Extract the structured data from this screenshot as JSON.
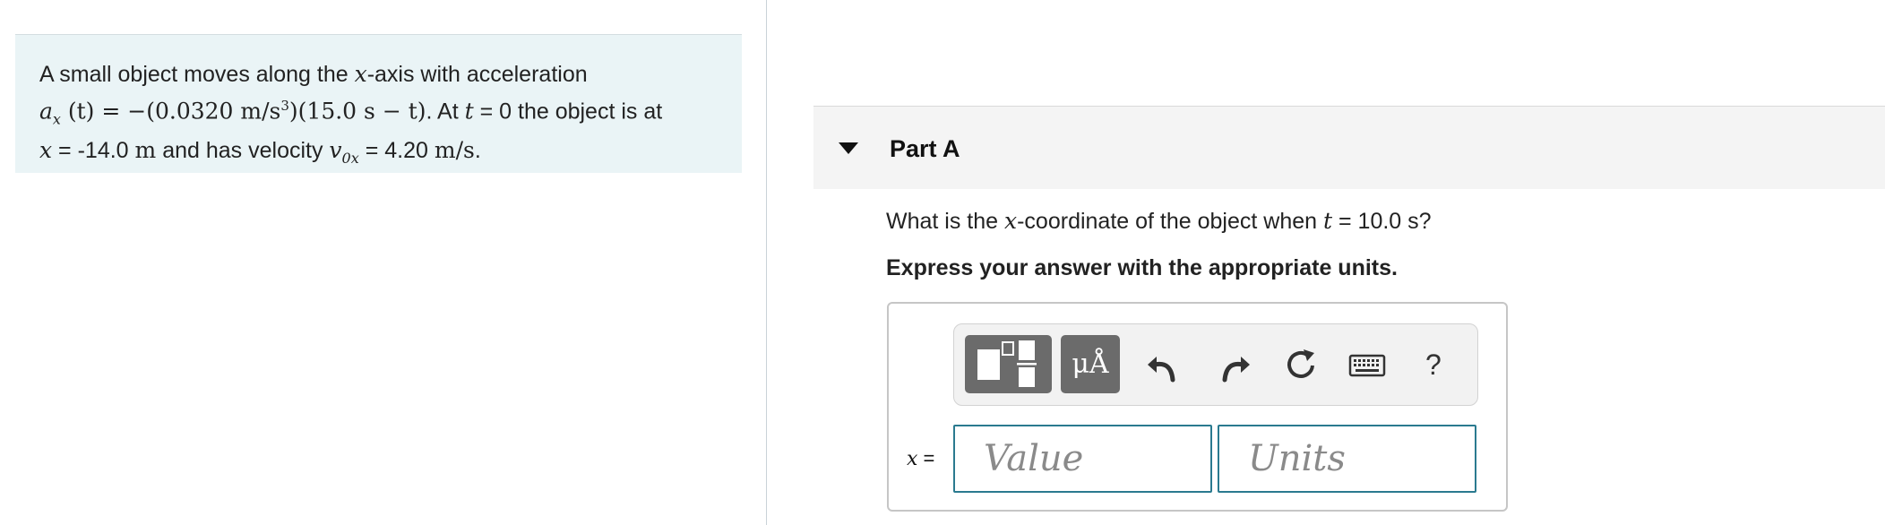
{
  "problem": {
    "line1_text": "A small object moves along the ",
    "x_var": "x",
    "line1_end": "-axis with acceleration",
    "accel_symbol": "a",
    "accel_sub": "x",
    "accel_expr_1": " (t) = −(0.0320 m/s",
    "accel_sup": "3",
    "accel_expr_2": ")(15.0 s − t)",
    "line2_mid": ". At ",
    "t_var": "t",
    "line2_end": " = 0 the object is at",
    "line3_x": "x",
    "line3_pos": " = -14.0 ",
    "line3_unit_m": "m",
    "line3_mid": " and has velocity ",
    "v_symbol": "v",
    "v_sub": "0x",
    "line3_vel": " = 4.20 ",
    "line3_vel_unit": "m/s",
    "line3_dot": "."
  },
  "part": {
    "title": "Part A"
  },
  "question": {
    "prefix": "What is the ",
    "x_var": "x",
    "middle": "-coordinate of the object when ",
    "t_var": "t",
    "suffix": " = 10.0 s?"
  },
  "instruction": "Express your answer with the appropriate units.",
  "toolbar": {
    "units_label": "μÅ",
    "help_label": "?",
    "icons": [
      "templates-icon",
      "units-icon",
      "undo-icon",
      "redo-icon",
      "reset-icon",
      "keyboard-icon",
      "help-icon"
    ]
  },
  "answer": {
    "var_label": "x",
    "eq": " =",
    "value_placeholder": "Value",
    "units_placeholder": "Units"
  },
  "colors": {
    "problem_bg": "#eaf4f6",
    "field_border": "#2a7a8f",
    "button_bg": "#6b6b6b"
  }
}
